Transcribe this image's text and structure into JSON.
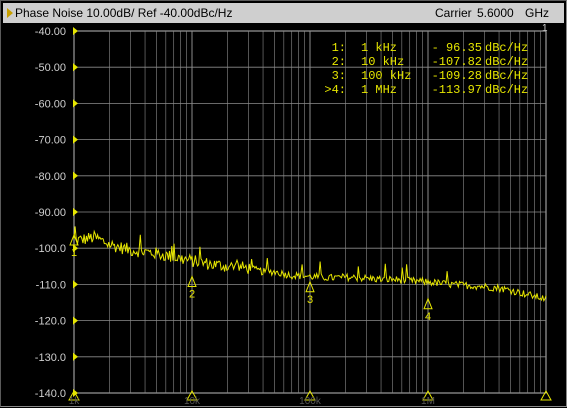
{
  "header": {
    "title": "Phase Noise 10.00dB/ Ref -40.00dBc/Hz",
    "carrier_label": "Carrier",
    "carrier_value": "5.6000",
    "carrier_unit": "GHz",
    "trace_number": "1"
  },
  "colors": {
    "trace": "#e6e600",
    "grid": "#8c8c8c",
    "marker_text": "#e6e600",
    "header_bg": "#cfcfcf"
  },
  "markers": [
    {
      "label": "1:",
      "freq": "1 kHz",
      "value": "- 96.35",
      "unit": "dBc/Hz"
    },
    {
      "label": "2:",
      "freq": "10 kHz",
      "value": "-107.82",
      "unit": "dBc/Hz"
    },
    {
      "label": "3:",
      "freq": "100 kHz",
      "value": "-109.28",
      "unit": "dBc/Hz"
    },
    {
      "label": ">4:",
      "freq": "1 MHz",
      "value": "-113.97",
      "unit": "dBc/Hz"
    }
  ],
  "chart_data": {
    "type": "line",
    "title": "Phase Noise 10.00dB/ Ref -40.00dBc/Hz",
    "xscale": "log",
    "xlim": [
      100,
      1000000
    ],
    "ylim": [
      -140,
      -40
    ],
    "x_ticks": [
      "1k",
      "10k",
      "100k",
      "1M"
    ],
    "x_tick_values": [
      100,
      1000,
      10000,
      100000,
      1000000
    ],
    "y_ticks": [
      "-40.00",
      "-50.00",
      "-60.00",
      "-70.00",
      "-80.00",
      "-90.00",
      "-100.0",
      "-110.0",
      "-120.0",
      "-130.0",
      "-140.0"
    ],
    "y_tick_values": [
      -40,
      -50,
      -60,
      -70,
      -80,
      -90,
      -100,
      -110,
      -120,
      -130,
      -140
    ],
    "grid": true,
    "series": [
      {
        "x": [
          100,
          150,
          200,
          300,
          400,
          500,
          700,
          1000,
          1500,
          2000,
          3000,
          4000,
          5000,
          7000,
          10000,
          15000,
          20000,
          30000,
          40000,
          50000,
          70000,
          100000,
          150000,
          200000,
          300000,
          400000,
          500000,
          700000,
          1000000
        ],
        "y": [
          -98.0,
          -97.0,
          -99.0,
          -100.5,
          -101.0,
          -101.5,
          -102.5,
          -103.5,
          -104.5,
          -105.0,
          -105.5,
          -106.5,
          -106.5,
          -107.5,
          -107.8,
          -108.2,
          -108.0,
          -108.3,
          -108.6,
          -108.6,
          -109.0,
          -109.3,
          -110.0,
          -110.2,
          -110.6,
          -111.0,
          -111.6,
          -112.8,
          -114.0
        ],
        "noise_amplitude_db": 2.5
      }
    ],
    "marker_points": [
      {
        "id": "1",
        "x": 100,
        "y": -96.35
      },
      {
        "id": "2",
        "x": 1000,
        "y": -107.82
      },
      {
        "id": "3",
        "x": 10000,
        "y": -109.28
      },
      {
        "id": "4",
        "x": 100000,
        "y": -113.97
      }
    ]
  }
}
